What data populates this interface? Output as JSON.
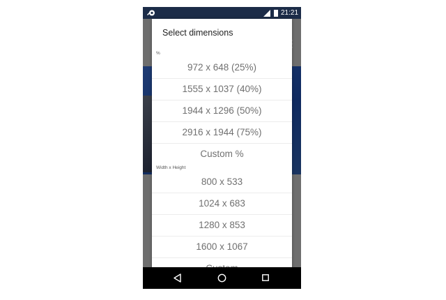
{
  "status_bar": {
    "time": "21:21",
    "left_icon": "app-notification-icon",
    "signal_icon": "signal-icon",
    "battery_icon": "battery-icon"
  },
  "dialog": {
    "title": "Select dimensions",
    "percent_section": {
      "label": "%",
      "options": [
        "972 x 648  (25%)",
        "1555 x 1037  (40%)",
        "1944 x 1296  (50%)",
        "2916 x 1944  (75%)",
        "Custom %"
      ]
    },
    "size_section": {
      "label": "Width x Height",
      "options": [
        "800 x 533",
        "1024 x 683",
        "1280 x 853",
        "1600 x 1067",
        "Custom"
      ]
    }
  },
  "nav_bar": {
    "back_icon": "back-icon",
    "home_icon": "home-icon",
    "recents_icon": "recents-icon"
  },
  "colors": {
    "status_bar": "#1c2c48",
    "scrim": "#6e6e6e",
    "dialog_bg": "#ffffff",
    "option_text": "#707070",
    "nav_bar": "#000000"
  }
}
